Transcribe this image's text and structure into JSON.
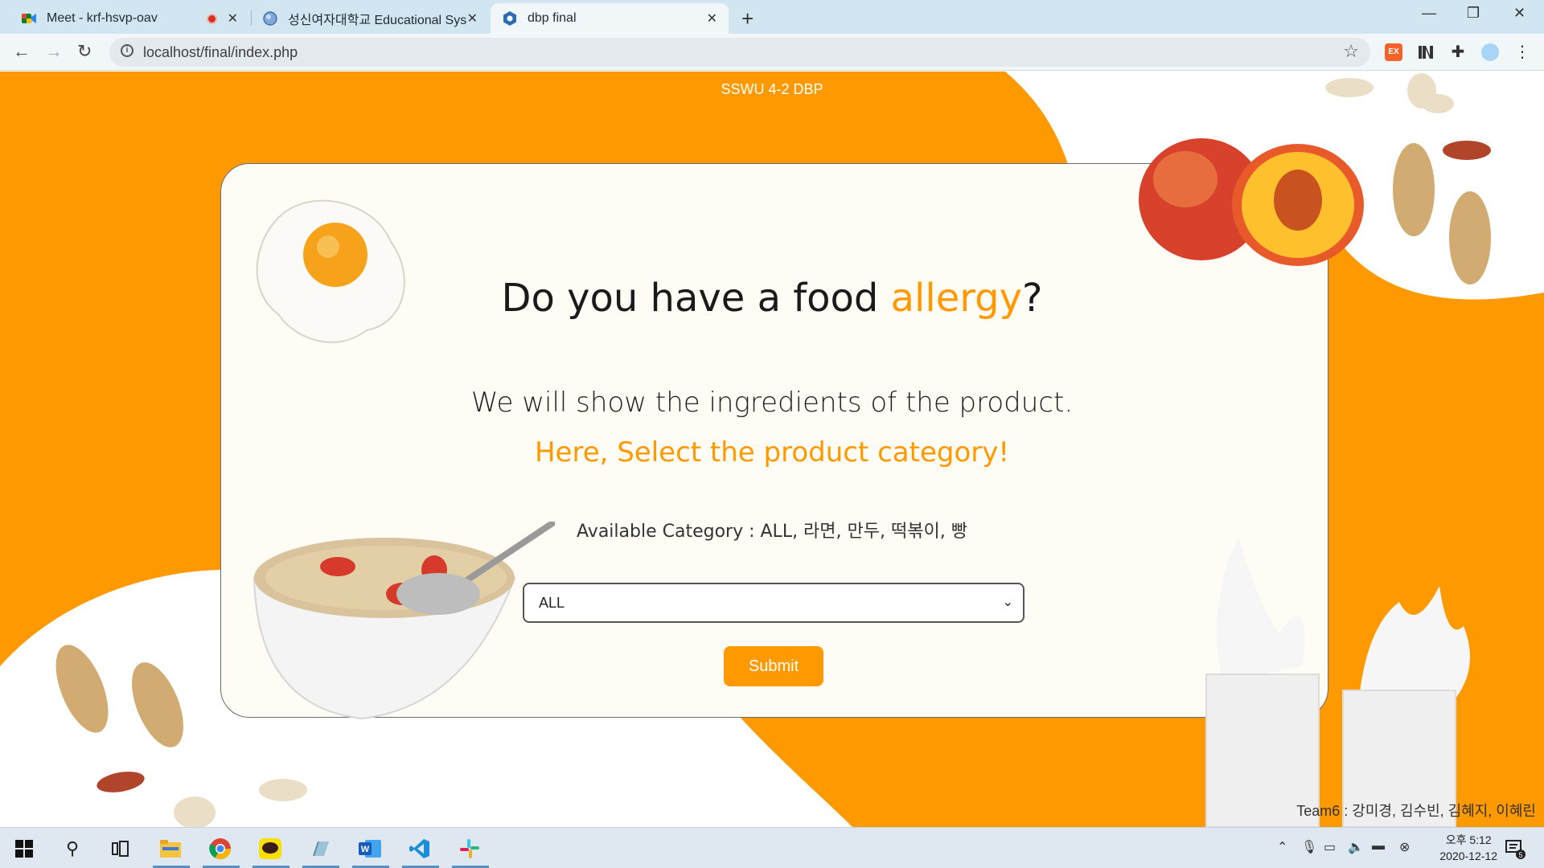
{
  "browser": {
    "tabs": [
      {
        "title": "Meet - krf-hsvp-oav",
        "icon": "google-meet-icon",
        "recording": true
      },
      {
        "title": "성신여자대학교 Educational Sys",
        "icon": "globe-icon"
      },
      {
        "title": "dbp final",
        "icon": "page-icon",
        "active": true
      }
    ],
    "url": "localhost/final/index.php",
    "extension_badge": "EX"
  },
  "page": {
    "top_label": "SSWU 4-2 DBP",
    "heading_prefix": "Do you have a food ",
    "heading_highlight": "allergy",
    "heading_suffix": "?",
    "subtext": "We will show the ingredients of the product.",
    "cta": "Here, Select the product category!",
    "available_label": "Available Category : ALL, 라면, 만두, 떡볶이, 빵",
    "select_value": "ALL",
    "submit_label": "Submit",
    "team": "Team6 : 강미경, 김수빈, 김혜지, 이혜린",
    "colors": {
      "accent": "#ff9900",
      "card": "#fffcf5"
    }
  },
  "taskbar": {
    "time": "오후 5:12",
    "date": "2020-12-12",
    "notification_count": "5"
  }
}
